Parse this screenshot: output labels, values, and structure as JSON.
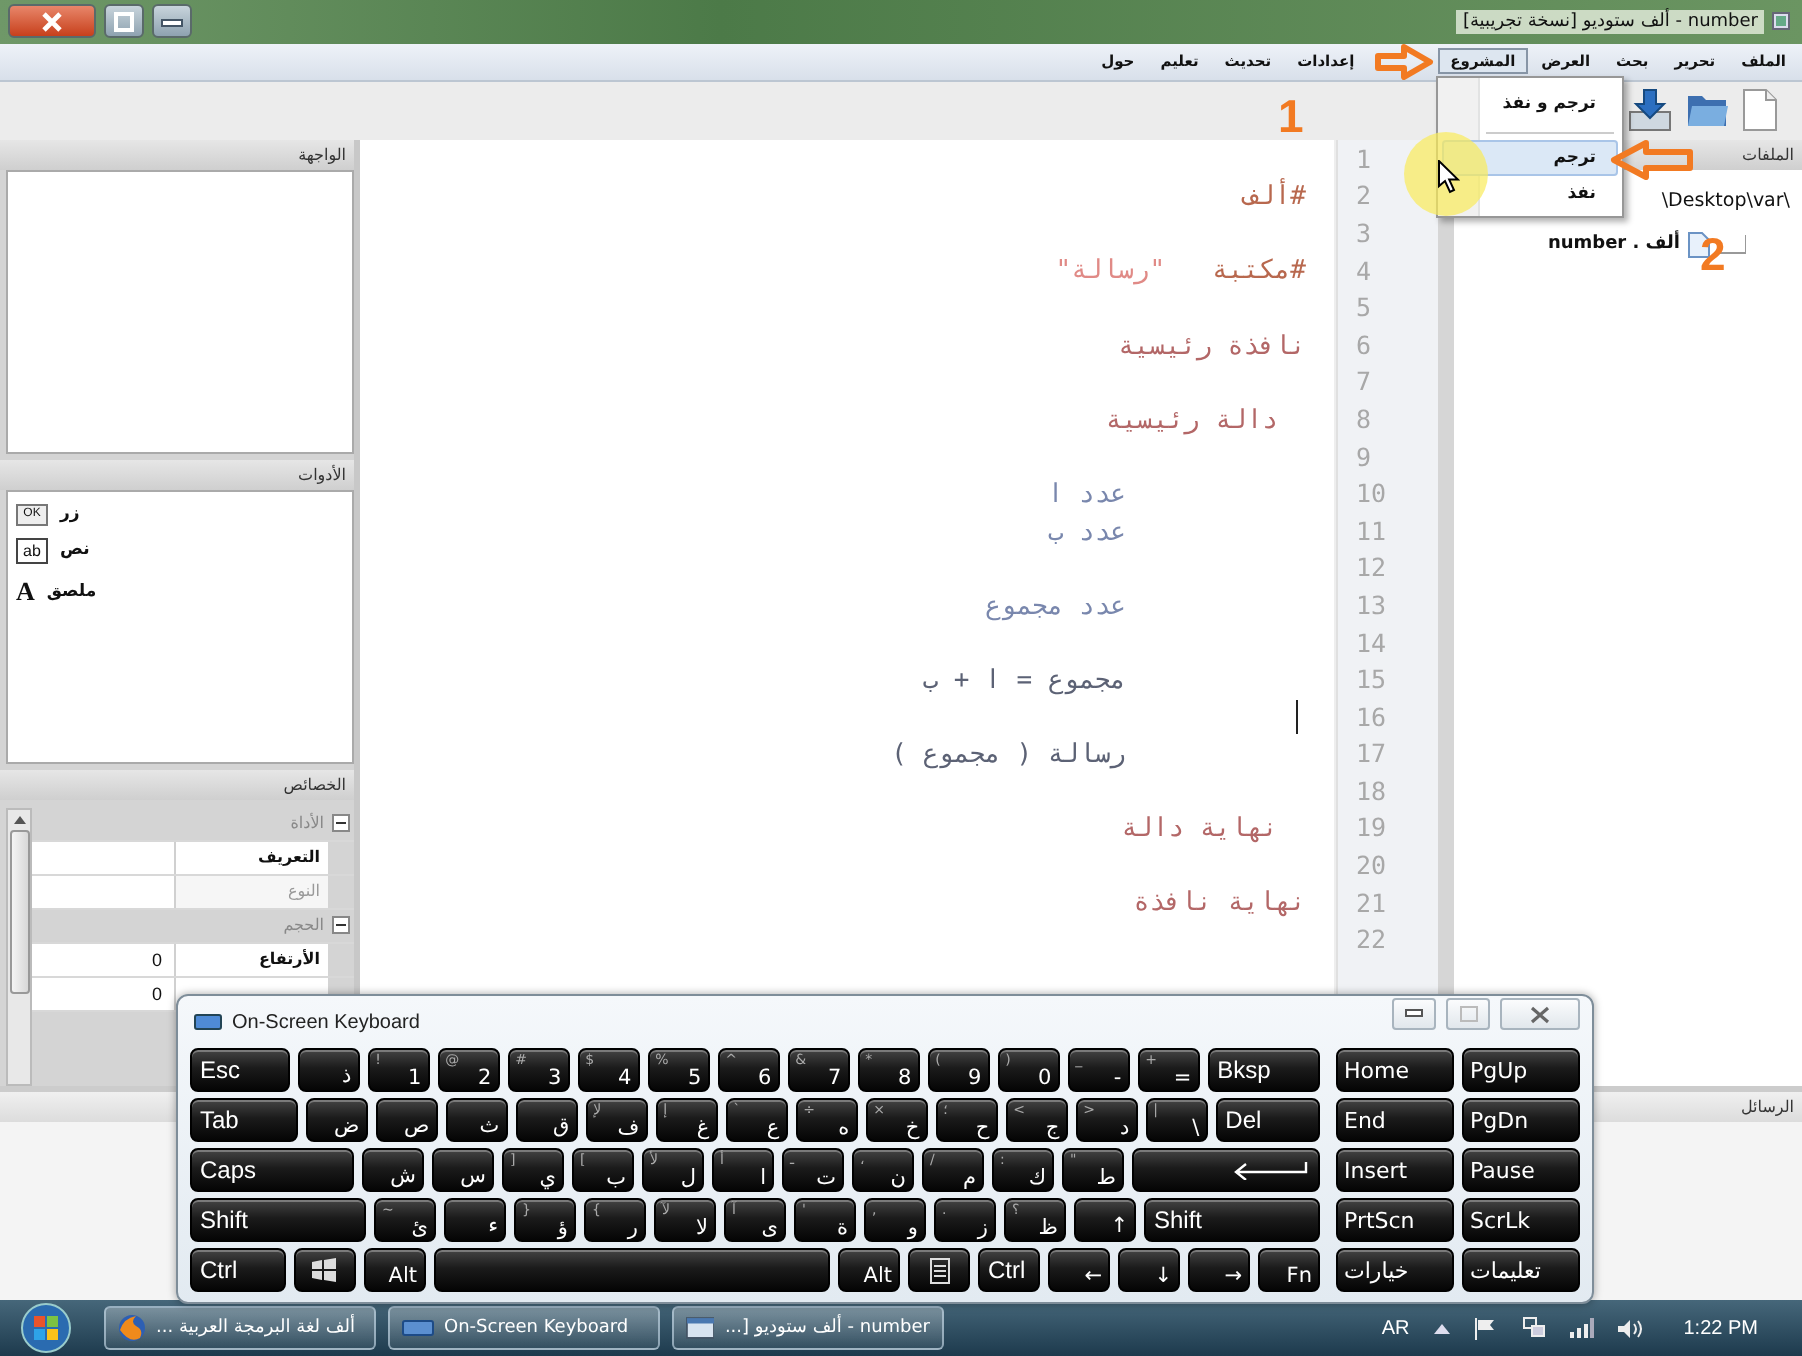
{
  "window": {
    "title": "number - ألف ستوديو [نسخة تجريبية]"
  },
  "menu": [
    {
      "label": "الملف",
      "selected": false
    },
    {
      "label": "تحرير",
      "selected": false
    },
    {
      "label": "بحث",
      "selected": false
    },
    {
      "label": "العرض",
      "selected": false
    },
    {
      "label": "المشروع",
      "selected": true
    },
    {
      "label": "إعدادات",
      "selected": false
    },
    {
      "label": "تحديث",
      "selected": false
    },
    {
      "label": "تعليم",
      "selected": false
    },
    {
      "label": "حول",
      "selected": false
    }
  ],
  "project_menu": [
    {
      "kind": "item",
      "label": "ترجم و نفذ",
      "selected": false
    },
    {
      "kind": "separator"
    },
    {
      "kind": "item",
      "label": "ترجم",
      "selected": true
    },
    {
      "kind": "item",
      "label": "نفذ",
      "selected": false
    }
  ],
  "annotations": [
    {
      "label": "1",
      "kind": "menu"
    },
    {
      "label": "2",
      "kind": "item"
    }
  ],
  "files": {
    "title": "الملفات",
    "tree": [
      {
        "label": "\\Desktop\\var\\",
        "children": [
          {
            "label": "ألف . number"
          }
        ]
      }
    ]
  },
  "interface_panel": {
    "title": "الواجهة"
  },
  "tools": {
    "title": "الأدوات",
    "items": [
      {
        "label": "زر",
        "kind": "button",
        "icon_text": "OK"
      },
      {
        "label": "نص",
        "kind": "text",
        "icon_text": "ab"
      },
      {
        "label": "ملصق",
        "kind": "label",
        "icon_text": "A"
      }
    ]
  },
  "properties": {
    "title": "الخصائص",
    "rows": [
      {
        "kind": "category",
        "label": "الأداة",
        "expanded": true
      },
      {
        "kind": "property",
        "label": "التعريف",
        "disabled": false
      },
      {
        "kind": "property",
        "label": "النوع",
        "disabled": true
      },
      {
        "kind": "category",
        "label": "الحجم",
        "expanded": true
      },
      {
        "kind": "property",
        "label": "الأرتفاع",
        "value": "0",
        "disabled": false
      },
      {
        "kind": "property",
        "value": "0"
      }
    ]
  },
  "editor": {
    "lines": [
      {
        "number": "1",
        "caret": false
      },
      {
        "number": "2",
        "caret": false,
        "kind": "directive",
        "parts": [
          {
            "text": "#ألف",
            "kind": "keyword"
          }
        ]
      },
      {
        "number": "3",
        "caret": false
      },
      {
        "number": "4",
        "caret": false,
        "kind": "directive",
        "parts": [
          {
            "text": "#مكتبة",
            "kind": "keyword"
          },
          {
            "text": "\"رسالة\"",
            "kind": "string"
          }
        ]
      },
      {
        "number": "5",
        "caret": false
      },
      {
        "number": "6",
        "caret": false,
        "kind": "window",
        "parts": [
          {
            "text": "نافذة رئيسية",
            "kind": "block"
          }
        ]
      },
      {
        "number": "7",
        "caret": false
      },
      {
        "number": "8",
        "caret": false,
        "kind": "function",
        "parts": [
          {
            "text": "دالة رئيسية",
            "kind": "block"
          }
        ]
      },
      {
        "number": "9",
        "caret": false
      },
      {
        "number": "10",
        "caret": false,
        "kind": "statement",
        "parts": [
          {
            "text": "عدد ا",
            "kind": "declaration"
          }
        ]
      },
      {
        "number": "11",
        "caret": false,
        "kind": "statement",
        "parts": [
          {
            "text": "عدد ب",
            "kind": "declaration"
          }
        ]
      },
      {
        "number": "12",
        "caret": false
      },
      {
        "number": "13",
        "caret": false,
        "kind": "statement",
        "parts": [
          {
            "text": "عدد مجموع",
            "kind": "declaration"
          }
        ]
      },
      {
        "number": "14",
        "caret": false
      },
      {
        "number": "15",
        "caret": false,
        "kind": "statement",
        "parts": [
          {
            "text": "مجموع = ا + ب",
            "kind": "expression"
          }
        ]
      },
      {
        "number": "16",
        "caret": true
      },
      {
        "number": "17",
        "caret": false,
        "kind": "statement",
        "parts": [
          {
            "text": "رسالة ( مجموع )",
            "kind": "expression"
          }
        ]
      },
      {
        "number": "18",
        "caret": false
      },
      {
        "number": "19",
        "caret": false,
        "kind": "function",
        "parts": [
          {
            "text": "نهاية دالة",
            "kind": "block"
          }
        ]
      },
      {
        "number": "20",
        "caret": false
      },
      {
        "number": "21",
        "caret": false,
        "kind": "window",
        "parts": [
          {
            "text": "نهاية نافذة",
            "kind": "block"
          }
        ]
      },
      {
        "number": "22",
        "caret": false
      }
    ]
  },
  "messages": {
    "title": "الرسائل"
  },
  "keyboard": {
    "title": "On-Screen Keyboard",
    "main_rows": [
      [
        {
          "kind": "text",
          "label": "Bksp"
        },
        {
          "kind": "char",
          "label": "=",
          "shift": "+"
        },
        {
          "kind": "char",
          "label": "-",
          "shift": "_"
        },
        {
          "kind": "char",
          "label": "0",
          "shift": ")"
        },
        {
          "kind": "char",
          "label": "9",
          "shift": "("
        },
        {
          "kind": "char",
          "label": "8",
          "shift": "*"
        },
        {
          "kind": "char",
          "label": "7",
          "shift": "&"
        },
        {
          "kind": "char",
          "label": "6",
          "shift": "^"
        },
        {
          "kind": "char",
          "label": "5",
          "shift": "%"
        },
        {
          "kind": "char",
          "label": "4",
          "shift": "$"
        },
        {
          "kind": "char",
          "label": "3",
          "shift": "#"
        },
        {
          "kind": "char",
          "label": "2",
          "shift": "@"
        },
        {
          "kind": "char",
          "label": "1",
          "shift": "!"
        },
        {
          "kind": "char",
          "label": "ذ"
        },
        {
          "kind": "text",
          "label": "Esc"
        }
      ],
      [
        {
          "kind": "text",
          "label": "Del"
        },
        {
          "kind": "char",
          "label": "\\",
          "shift": "|"
        },
        {
          "kind": "char",
          "label": "د",
          "shift": ">"
        },
        {
          "kind": "char",
          "label": "ج",
          "shift": "<"
        },
        {
          "kind": "char",
          "label": "ح",
          "shift": "؛"
        },
        {
          "kind": "char",
          "label": "خ",
          "shift": "×"
        },
        {
          "kind": "char",
          "label": "ه",
          "shift": "÷"
        },
        {
          "kind": "char",
          "label": "ع",
          "shift": "`"
        },
        {
          "kind": "char",
          "label": "غ",
          "shift": "إ"
        },
        {
          "kind": "char",
          "label": "ف",
          "shift": "لإ"
        },
        {
          "kind": "char",
          "label": "ق"
        },
        {
          "kind": "char",
          "label": "ث"
        },
        {
          "kind": "char",
          "label": "ص"
        },
        {
          "kind": "char",
          "label": "ض"
        },
        {
          "kind": "text",
          "label": "Tab"
        }
      ],
      [
        {
          "kind": "enter"
        },
        {
          "kind": "char",
          "label": "ط",
          "shift": "\""
        },
        {
          "kind": "char",
          "label": "ك",
          "shift": ":"
        },
        {
          "kind": "char",
          "label": "م",
          "shift": "/"
        },
        {
          "kind": "char",
          "label": "ن",
          "shift": "،"
        },
        {
          "kind": "char",
          "label": "ت",
          "shift": "ـ"
        },
        {
          "kind": "char",
          "label": "ا",
          "shift": "أ"
        },
        {
          "kind": "char",
          "label": "ل",
          "shift": "لأ"
        },
        {
          "kind": "char",
          "label": "ب",
          "shift": "["
        },
        {
          "kind": "char",
          "label": "ي",
          "shift": "]"
        },
        {
          "kind": "char",
          "label": "س"
        },
        {
          "kind": "char",
          "label": "ش"
        },
        {
          "kind": "text",
          "label": "Caps"
        }
      ],
      [
        {
          "kind": "text",
          "label": "Shift"
        },
        {
          "kind": "char",
          "label": "↑"
        },
        {
          "kind": "char",
          "label": "ظ",
          "shift": "؟"
        },
        {
          "kind": "char",
          "label": "ز",
          "shift": "."
        },
        {
          "kind": "char",
          "label": "و",
          "shift": ","
        },
        {
          "kind": "char",
          "label": "ة",
          "shift": "'"
        },
        {
          "kind": "char",
          "label": "ى",
          "shift": "آ"
        },
        {
          "kind": "char",
          "label": "لا",
          "shift": "لآ"
        },
        {
          "kind": "char",
          "label": "ر",
          "shift": "{"
        },
        {
          "kind": "char",
          "label": "ؤ",
          "shift": "}"
        },
        {
          "kind": "char",
          "label": "ء"
        },
        {
          "kind": "char",
          "label": "ئ",
          "shift": "~"
        },
        {
          "kind": "text",
          "label": "Shift"
        }
      ],
      [
        {
          "kind": "char",
          "label": "Fn"
        },
        {
          "kind": "char",
          "label": "→"
        },
        {
          "kind": "char",
          "label": "↓"
        },
        {
          "kind": "char",
          "label": "←"
        },
        {
          "kind": "text",
          "label": "Ctrl"
        },
        {
          "kind": "menu"
        },
        {
          "kind": "char",
          "label": "Alt"
        },
        {
          "kind": "space"
        },
        {
          "kind": "char",
          "label": "Alt"
        },
        {
          "kind": "windows"
        },
        {
          "kind": "text",
          "label": "Ctrl"
        }
      ]
    ],
    "nav_rows": [
      [
        "PgUp",
        "Home"
      ],
      [
        "PgDn",
        "End"
      ],
      [
        "Pause",
        "Insert"
      ],
      [
        "ScrLk",
        "PrtScn"
      ],
      [
        "تعليمات",
        "خيارات"
      ]
    ]
  },
  "taskbar": {
    "tasks": [
      {
        "label": "number - ألف ستوديو [...",
        "kind": "editor"
      },
      {
        "label": "On-Screen Keyboard",
        "kind": "keyboard"
      },
      {
        "label": "ألف لغة البرمجة العربية ...",
        "kind": "browser"
      }
    ],
    "language": "AR",
    "clock": "1:22 PM"
  }
}
